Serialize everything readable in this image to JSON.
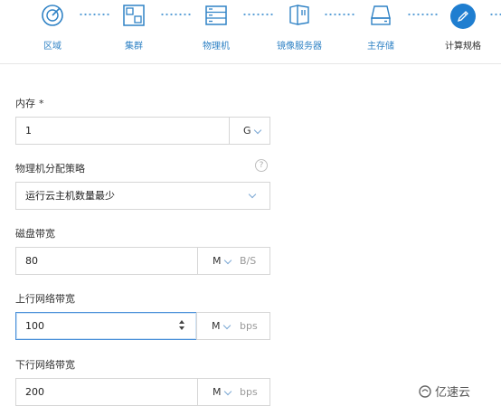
{
  "steps": [
    {
      "label": "区域",
      "icon": "target-icon"
    },
    {
      "label": "集群",
      "icon": "cluster-icon"
    },
    {
      "label": "物理机",
      "icon": "server-icon"
    },
    {
      "label": "镜像服务器",
      "icon": "image-server-icon"
    },
    {
      "label": "主存储",
      "icon": "storage-icon"
    },
    {
      "label": "计算规格",
      "icon": "pencil-icon",
      "active": true
    }
  ],
  "form": {
    "memory": {
      "label": "内存",
      "required_mark": "*",
      "value": "1",
      "unit": "G"
    },
    "host_policy": {
      "label": "物理机分配策略",
      "help": "?",
      "value": "运行云主机数量最少"
    },
    "disk_bandwidth": {
      "label": "磁盘带宽",
      "value": "80",
      "unit": "M",
      "suffix": "B/S"
    },
    "upload_bandwidth": {
      "label": "上行网络带宽",
      "value": "100",
      "unit": "M",
      "suffix": "bps"
    },
    "download_bandwidth": {
      "label": "下行网络带宽",
      "value": "200",
      "unit": "M",
      "suffix": "bps"
    }
  },
  "watermark": {
    "text": "亿速云"
  },
  "colors": {
    "accent": "#1f7ed0",
    "step_label": "#2f82c5",
    "border": "#d6d6d6"
  }
}
